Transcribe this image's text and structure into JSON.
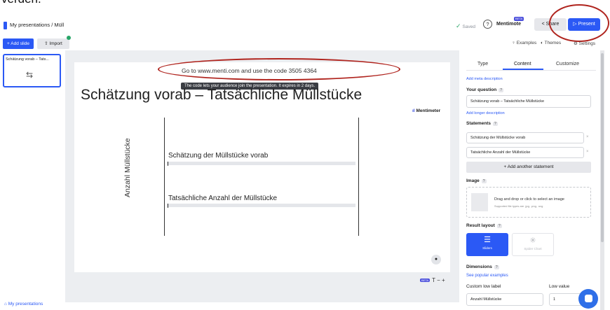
{
  "top_fragment": "verden.",
  "header": {
    "breadcrumb": "My presentations / Müll",
    "saved": "Saved",
    "help": "?",
    "mentimote": "Mentimote",
    "mentimote_badge": "BETA",
    "share": "Share",
    "present": "Present"
  },
  "toolbar": {
    "add_slide": "+ Add slide",
    "import": "Import",
    "examples": "Examples",
    "themes": "Themes",
    "settings": "Settings"
  },
  "sidebar": {
    "slides": [
      {
        "title": "Schätzung vorab – Tats..."
      }
    ],
    "footer_link": "My presentations"
  },
  "slide": {
    "join_text": "Go to www.menti.com and use the code 3505 4364",
    "tooltip": "The code lets your audience join the presentation. It expires in 2 days.",
    "title": "Schätzung vorab – Tatsächliche Müllstücke",
    "logo": "Mentimeter",
    "y_axis_label": "Anzahl Müllstücke",
    "statements": [
      {
        "label": "Schätzung der Müllstücke vorab",
        "value": 0
      },
      {
        "label": "Tatsächliche Anzahl der Müllstücke",
        "value": 0
      }
    ]
  },
  "canvas_tools": {
    "beta": "BETA",
    "text_tool": "T − +"
  },
  "panel": {
    "tabs": [
      "Type",
      "Content",
      "Customize"
    ],
    "active_tab": "Content",
    "add_meta": "Add meta description",
    "question_label": "Your question",
    "question_value": "Schätzung vorab – Tatsächliche Müllstücke",
    "add_longer": "Add longer description",
    "statements_label": "Statements",
    "statements": [
      "Schätzung der Müllstücke vorab",
      "Tatsächliche Anzahl der Müllstücke"
    ],
    "add_statement": "+ Add another statement",
    "image_label": "Image",
    "image_drop": "Drag and drop or click to select an image",
    "image_supported": "Supported file types are .jpg, .png, .svg",
    "result_layout_label": "Result layout",
    "layouts": [
      {
        "label": "Sliders",
        "selected": true
      },
      {
        "label": "Spider Chart",
        "selected": false
      }
    ],
    "dimensions_label": "Dimensions",
    "see_examples": "See popular examples",
    "custom_low_label": "Custom low label",
    "low_value_label": "Low value",
    "custom_low_value": "Anzahl Müllstücke",
    "low_value": "1"
  },
  "colors": {
    "accent": "#2b59f5",
    "annotation": "#b0241e",
    "saved_check": "#2fa86b"
  }
}
